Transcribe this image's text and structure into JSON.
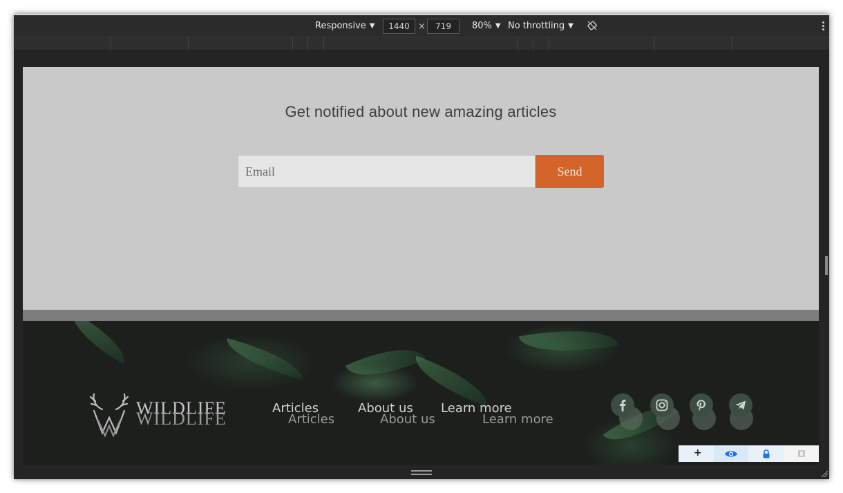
{
  "toolbar": {
    "device": "Responsive",
    "width": "1440",
    "height": "719",
    "times": "×",
    "zoom": "80%",
    "throttling": "No throttling"
  },
  "newsletter": {
    "headline": "Get notified about new amazing articles",
    "email_placeholder": "Email",
    "send_label": "Send",
    "accent_color": "#d5642a"
  },
  "footer": {
    "brand": "WILDLIFE",
    "nav": [
      {
        "label": "Articles"
      },
      {
        "label": "About us"
      },
      {
        "label": "Learn more"
      }
    ],
    "social": [
      "facebook-icon",
      "instagram-icon",
      "pinterest-icon",
      "telegram-icon"
    ]
  },
  "widget": {
    "add": "+",
    "icons": [
      "eye-icon",
      "lock-icon",
      "box-icon"
    ]
  }
}
